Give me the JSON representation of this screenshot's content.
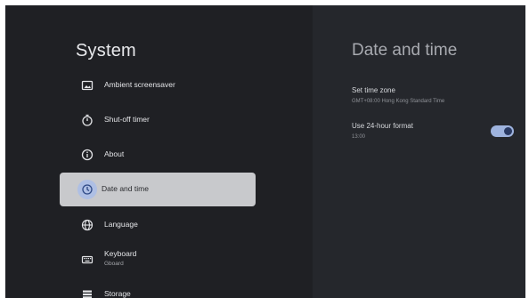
{
  "left_panel": {
    "title": "System",
    "items": [
      {
        "label": "Ambient screensaver",
        "icon": "screensaver-icon"
      },
      {
        "label": "Shut-off timer",
        "icon": "timer-icon"
      },
      {
        "label": "About",
        "icon": "info-icon"
      },
      {
        "label": "Date and time",
        "icon": "clock-icon",
        "selected": true
      },
      {
        "label": "Language",
        "icon": "globe-icon"
      },
      {
        "label": "Keyboard",
        "sublabel": "Gboard",
        "icon": "keyboard-icon"
      },
      {
        "label": "Storage",
        "icon": "storage-icon"
      }
    ]
  },
  "right_panel": {
    "title": "Date and time",
    "settings": [
      {
        "label": "Set time zone",
        "value": "GMT+08:00 Hong Kong Standard Time"
      },
      {
        "label": "Use 24-hour format",
        "value": "13:00",
        "toggle": true
      }
    ]
  },
  "colors": {
    "background": "#1f2024",
    "detail_background": "#25272c",
    "selected_item": "#c8c9cc",
    "accent": "#9eb3de"
  }
}
